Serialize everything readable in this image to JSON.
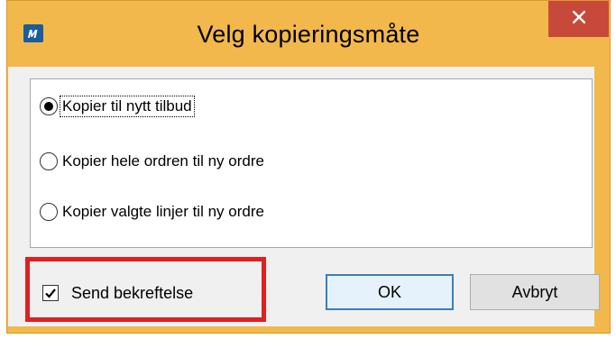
{
  "window": {
    "title": "Velg kopieringsmåte",
    "app_icon": "m-logo-icon",
    "close_icon": "close-icon",
    "close_color": "#c7493a",
    "frame_color": "#f2b84c"
  },
  "options": [
    {
      "label": "Kopier til nytt tilbud",
      "selected": true
    },
    {
      "label": "Kopier hele ordren til ny ordre",
      "selected": false
    },
    {
      "label": "Kopier valgte linjer til ny ordre",
      "selected": false
    }
  ],
  "confirmation": {
    "label": "Send bekreftelse",
    "checked": true,
    "highlight_color": "#e02020"
  },
  "buttons": {
    "ok": "OK",
    "cancel": "Avbryt"
  }
}
